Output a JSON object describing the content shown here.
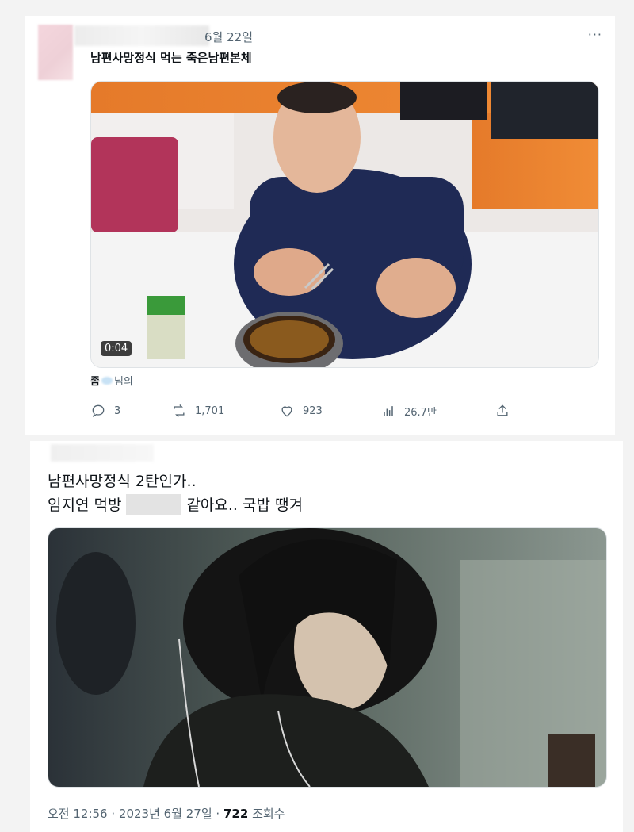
{
  "tweet1": {
    "date": "6월 22일",
    "text": "남편사망정식 먹는 죽은남편본체",
    "more_icon": "···",
    "video_duration": "0:04",
    "quote_prefix": "좀",
    "quote_suffix": "님의",
    "stats": {
      "replies": "3",
      "retweets": "1,701",
      "likes": "923",
      "views": "26.7만"
    }
  },
  "tweet2": {
    "line1": "남편사망정식 2탄인가..",
    "line2_a": "임지연 먹방",
    "line2_b": "같아요.. 국밥 땡겨",
    "meta_time": "오전 12:56 · 2023년 6월 27일 ·",
    "meta_views": "722",
    "meta_views_label": "조회수"
  },
  "colors": {
    "text_primary": "#0f1419",
    "text_secondary": "#536471",
    "background": "#f3f3f3",
    "card": "#ffffff"
  },
  "icons": [
    "more-icon",
    "reply-icon",
    "retweet-icon",
    "like-icon",
    "views-icon",
    "share-icon"
  ]
}
